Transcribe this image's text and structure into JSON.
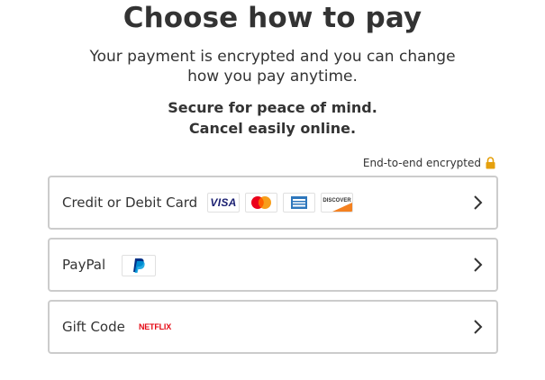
{
  "header": {
    "title": "Choose how to pay",
    "subtitle": "Your payment is encrypted and you can change how you pay anytime.",
    "secure_line1": "Secure for peace of mind.",
    "secure_line2": "Cancel easily online."
  },
  "encryption": {
    "label": "End-to-end encrypted",
    "icon": "lock-icon",
    "icon_color": "#e5a00d"
  },
  "payment_options": [
    {
      "label": "Credit or Debit Card",
      "logos": [
        "visa-logo",
        "mastercard-logo",
        "amex-logo",
        "discover-logo"
      ]
    },
    {
      "label": "PayPal",
      "logos": [
        "paypal-logo"
      ]
    },
    {
      "label": "Gift Code",
      "logos": [
        "netflix-logo"
      ],
      "logo_text": "NETFLIX"
    }
  ],
  "logo_text": {
    "visa": "VISA",
    "discover": "DISCOVER"
  },
  "colors": {
    "text": "#333333",
    "border": "#cccccc",
    "netflix_red": "#e50914",
    "visa_blue": "#1a1f71",
    "paypal_blue": "#003087"
  }
}
